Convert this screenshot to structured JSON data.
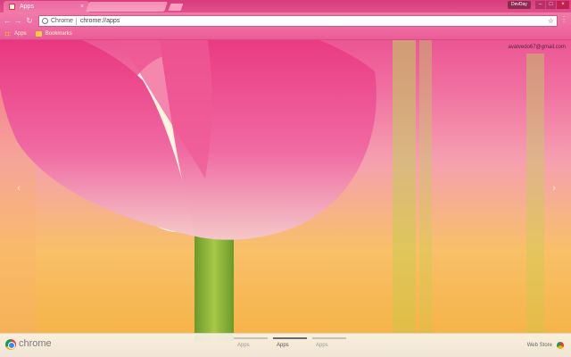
{
  "tabs": [
    {
      "title": "Apps",
      "close_glyph": "×"
    }
  ],
  "window": {
    "profile_name": "DevDay",
    "minimize_glyph": "–",
    "maximize_glyph": "□",
    "close_glyph": "×"
  },
  "toolbar": {
    "back_glyph": "←",
    "forward_glyph": "→",
    "reload_glyph": "↻",
    "omnibox_chip": "Chrome",
    "url": "chrome://apps",
    "star_glyph": "☆",
    "menu_glyph": "⋮"
  },
  "bookmarks": [
    {
      "label": "Apps",
      "icon": "apps-grid-icon"
    },
    {
      "label": "Bookmarks",
      "icon": "folder-icon"
    }
  ],
  "user": {
    "email": "avatvedo67@gmail.com"
  },
  "nav": {
    "left_glyph": "‹",
    "right_glyph": "›"
  },
  "bottom_bar": {
    "brand": "chrome",
    "pages": [
      {
        "label": "Apps",
        "active": false
      },
      {
        "label": "Apps",
        "active": true
      },
      {
        "label": "Apps",
        "active": false
      }
    ],
    "webstore_label": "Web Store"
  },
  "colors": {
    "frame": "#d83c7c",
    "toolbar": "#ee6aa0",
    "bookmark_text": "#fff8d0"
  }
}
